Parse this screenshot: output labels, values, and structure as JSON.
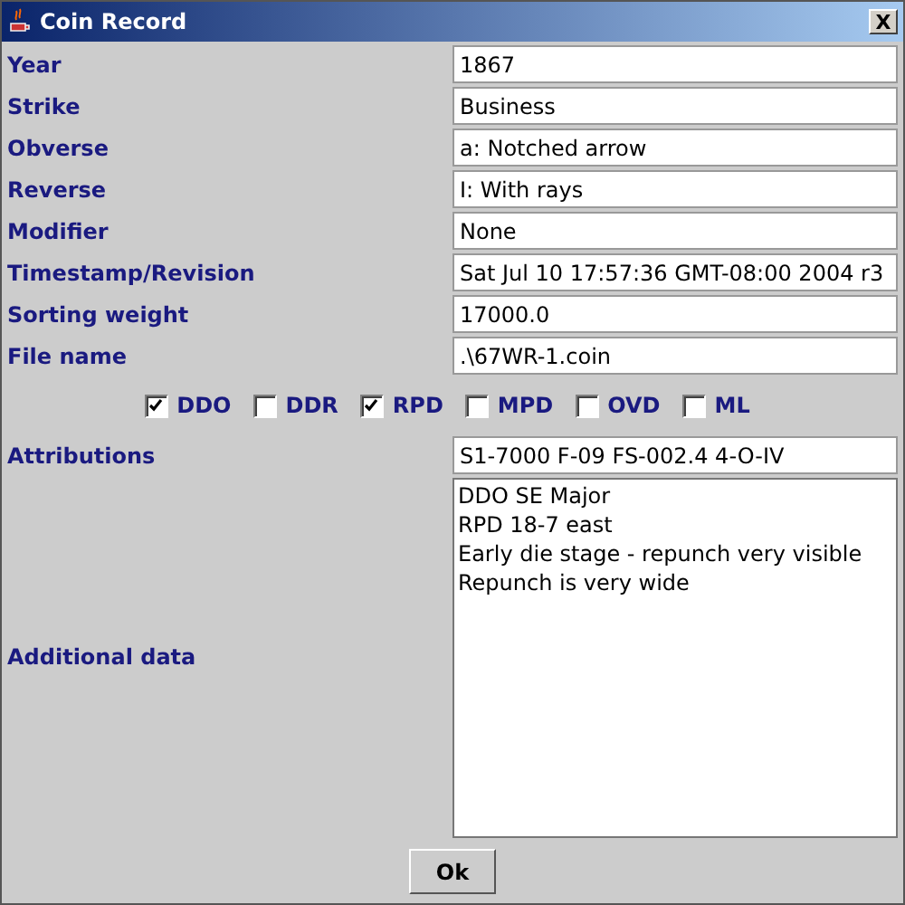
{
  "window": {
    "title": "Coin Record",
    "close": "X"
  },
  "fields": [
    {
      "label": "Year",
      "value": "1867"
    },
    {
      "label": "Strike",
      "value": "Business"
    },
    {
      "label": "Obverse",
      "value": "a: Notched arrow"
    },
    {
      "label": "Reverse",
      "value": "I: With rays"
    },
    {
      "label": "Modifier",
      "value": "None"
    },
    {
      "label": "Timestamp/Revision",
      "value": "Sat Jul 10 17:57:36 GMT-08:00 2004 r3"
    },
    {
      "label": "Sorting weight",
      "value": "17000.0"
    },
    {
      "label": "File name",
      "value": ".\\67WR-1.coin"
    }
  ],
  "checkboxes": [
    {
      "label": "DDO",
      "checked": true
    },
    {
      "label": "DDR",
      "checked": false
    },
    {
      "label": "RPD",
      "checked": true
    },
    {
      "label": "MPD",
      "checked": false
    },
    {
      "label": "OVD",
      "checked": false
    },
    {
      "label": "ML",
      "checked": false
    }
  ],
  "attributions": {
    "label": "Attributions",
    "value": "S1-7000 F-09 FS-002.4 4-O-IV"
  },
  "additional_data": {
    "label": "Additional data",
    "lines": [
      "DDO SE Major",
      "RPD 18-7 east",
      "Early die stage - repunch very visible",
      "Repunch is very wide"
    ]
  },
  "buttons": [
    "Ok"
  ]
}
